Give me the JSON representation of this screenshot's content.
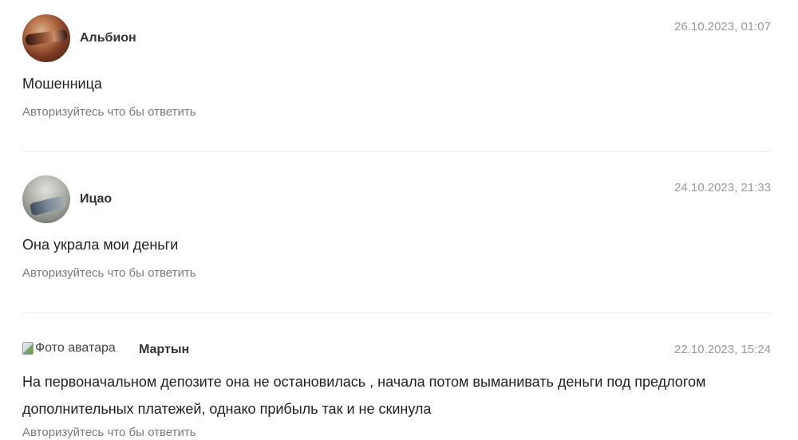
{
  "comments": [
    {
      "author": "Альбион",
      "date": "26.10.2023, 01:07",
      "text": "Мошенница",
      "reply_label": "Авторизуйтесь что бы ответить"
    },
    {
      "author": "Ицао",
      "date": "24.10.2023, 21:33",
      "text": "Она украла мои деньги",
      "reply_label": "Авторизуйтесь что бы ответить"
    },
    {
      "author": "Мартын",
      "date": "22.10.2023, 15:24",
      "avatar_alt": "Фото аватара",
      "text": "На первоначальном депозите она не остановилась , начала потом выманивать деньги под предлогом дополнительных платежей, однако прибыль так и не скинула",
      "reply_label": "Авторизуйтесь что бы ответить"
    }
  ]
}
